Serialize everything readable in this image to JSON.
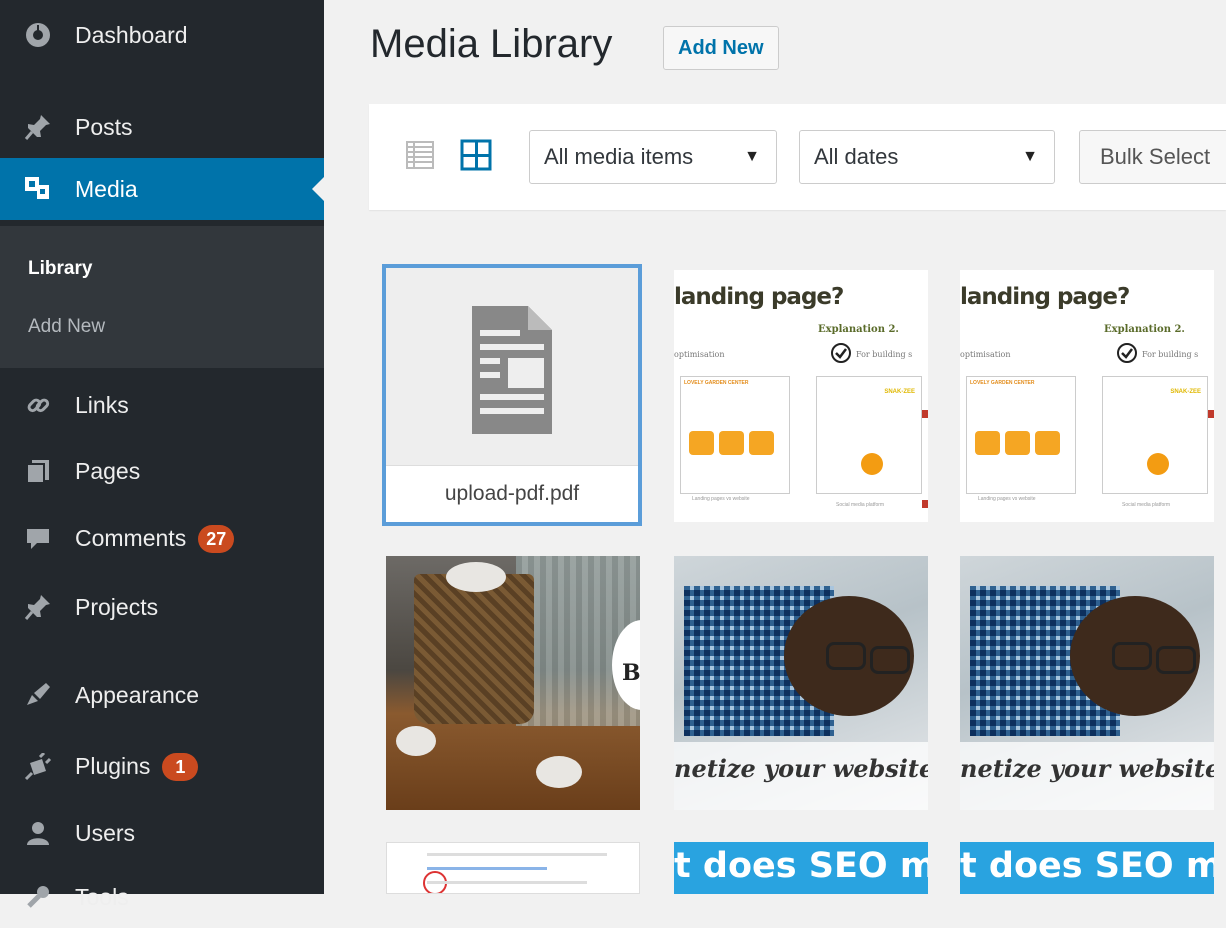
{
  "sidebar": {
    "items": [
      {
        "label": "Dashboard",
        "icon": "dashboard-icon"
      },
      {
        "label": "Posts",
        "icon": "pin-icon"
      },
      {
        "label": "Media",
        "icon": "media-icon",
        "active": true
      },
      {
        "label": "Links",
        "icon": "link-icon"
      },
      {
        "label": "Pages",
        "icon": "pages-icon"
      },
      {
        "label": "Comments",
        "icon": "comment-icon",
        "badge": "27"
      },
      {
        "label": "Projects",
        "icon": "pin-icon"
      },
      {
        "label": "Appearance",
        "icon": "brush-icon"
      },
      {
        "label": "Plugins",
        "icon": "plugin-icon",
        "badge": "1"
      },
      {
        "label": "Users",
        "icon": "user-icon"
      },
      {
        "label": "Tools",
        "icon": "wrench-icon"
      }
    ],
    "submenu": [
      {
        "label": "Library",
        "current": true
      },
      {
        "label": "Add New"
      }
    ]
  },
  "header": {
    "title": "Media Library",
    "add_new": "Add New"
  },
  "toolbar": {
    "media_filter": "All media items",
    "date_filter": "All dates",
    "bulk_select": "Bulk Select"
  },
  "grid": {
    "pdf_filename": "upload-pdf.pdf",
    "thumb_landing": {
      "headline": "landing page?",
      "explanation": "Explanation 2.",
      "optimisation": "optimisation",
      "building": "For building s",
      "site_one": "LOVELY GARDEN CENTER",
      "site_two": "SNAK-ZEE",
      "caption_one": "Landing pages vs website",
      "caption_two": "Social media platform"
    },
    "thumb_monetize": "netize your website ...",
    "thumb_basket_letter": "B",
    "thumb_seo": "t does SEO m"
  },
  "colors": {
    "sidebar_bg": "#23282d",
    "submenu_bg": "#32373c",
    "active_blue": "#0073aa",
    "badge": "#ca4a1f",
    "selected_outline": "#5b9dd9"
  }
}
